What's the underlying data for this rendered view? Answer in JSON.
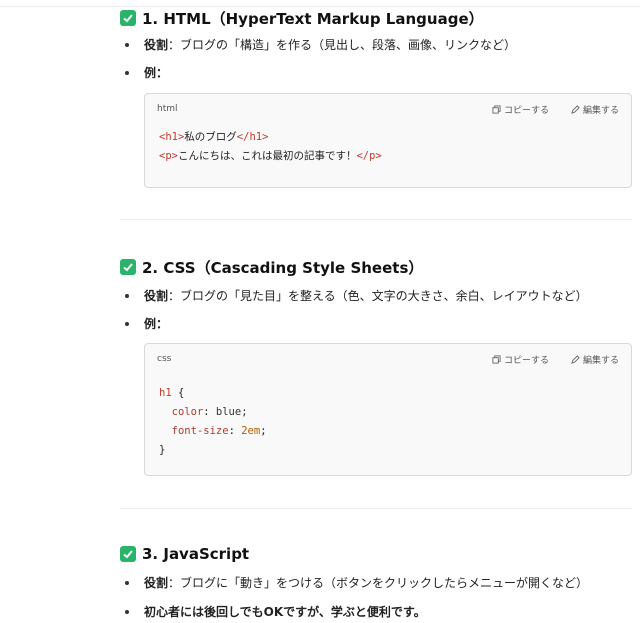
{
  "sections": [
    {
      "heading": "1. HTML（HyperText Markup Language）",
      "role_label": "役割",
      "role_text": "：ブログの「構造」を作る（見出し、段落、画像、リンクなど）",
      "example_label": "例：",
      "code": {
        "lang": "html",
        "copy_label": "コピーする",
        "edit_label": "編集する",
        "lines": [
          {
            "open_tag": "<h1>",
            "text": "私のブログ",
            "close_tag": "</h1>"
          },
          {
            "open_tag": "<p>",
            "text": "こんにちは、これは最初の記事です！",
            "close_tag": "</p>"
          }
        ]
      }
    },
    {
      "heading": "2. CSS（Cascading Style Sheets）",
      "role_label": "役割",
      "role_text": "：ブログの「見た目」を整える（色、文字の大きさ、余白、レイアウトなど）",
      "example_label": "例：",
      "code": {
        "lang": "css",
        "copy_label": "コピーする",
        "edit_label": "編集する",
        "selector": "h1",
        "brace_open": " {",
        "decl1_prop": "color",
        "decl1_val": " blue;",
        "decl2_prop": "font-size",
        "decl2_val": " 2em",
        "brace_close": "}"
      }
    },
    {
      "heading": "3. JavaScript",
      "role_label": "役割",
      "role_text": "：ブログに「動き」をつける（ボタンをクリックしたらメニューが開くなど）",
      "note": "初心者には後回しでもOKですが、学ぶと便利です。"
    }
  ],
  "colors": {
    "check": "#2ab36b",
    "tag": "#c0392b",
    "number": "#b85c00"
  }
}
